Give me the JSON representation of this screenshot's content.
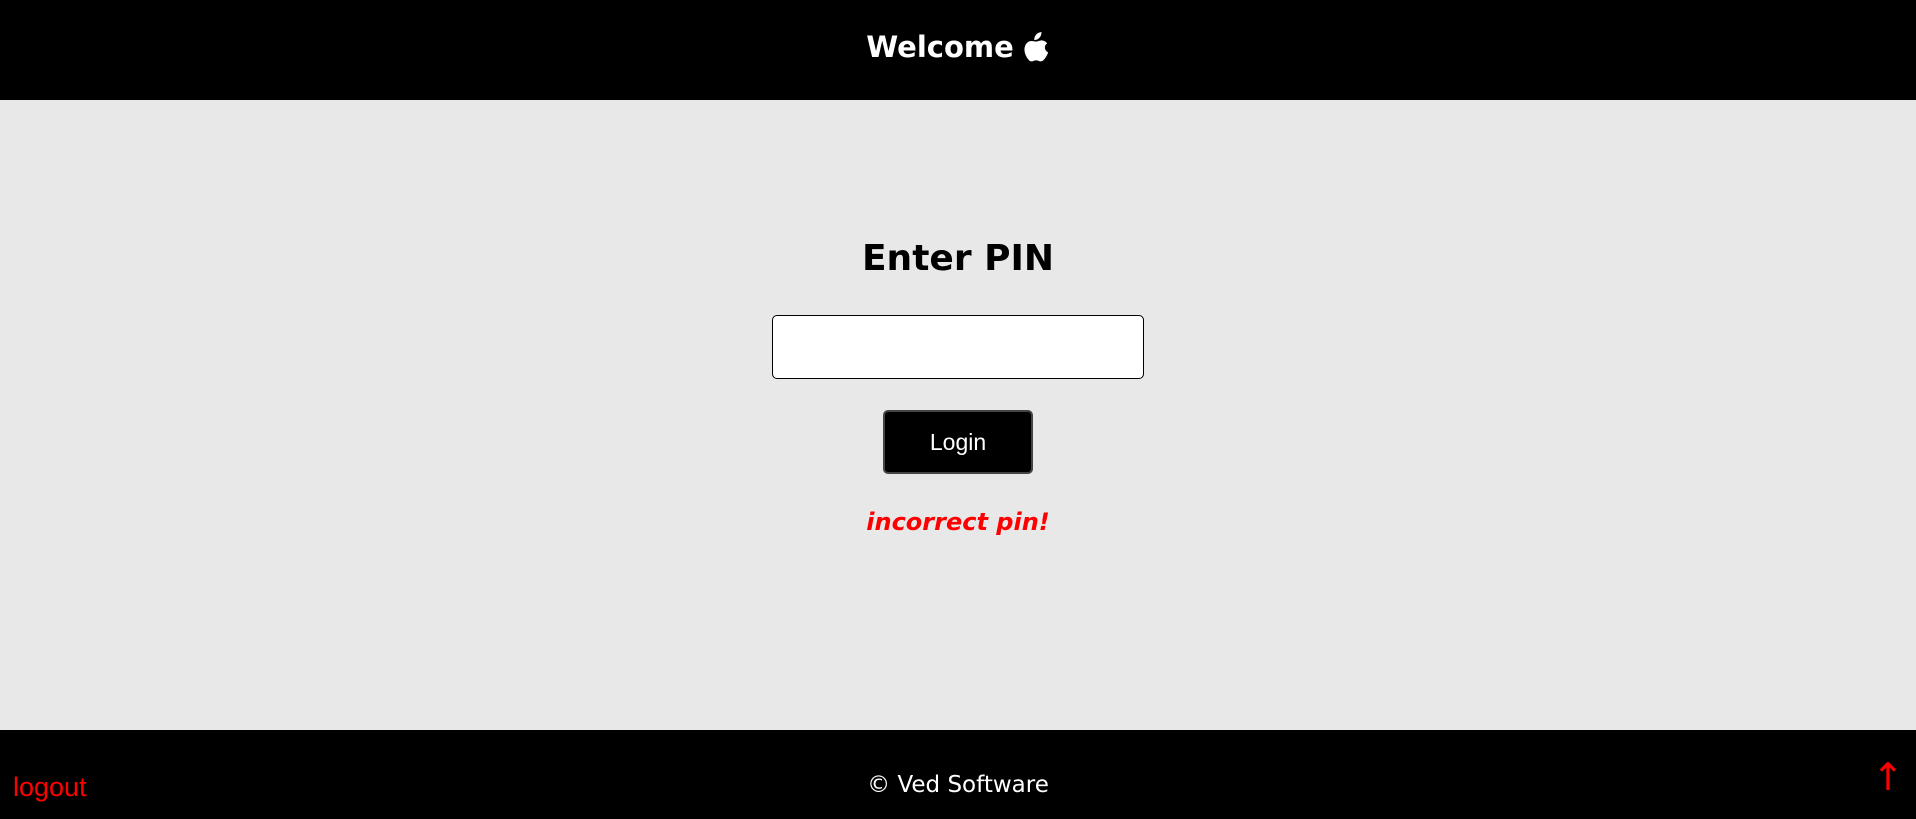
{
  "header": {
    "title": "Welcome",
    "icon": "apple-icon"
  },
  "login": {
    "heading": "Enter PIN",
    "pin_value": "",
    "pin_placeholder": "",
    "button_label": "Login",
    "error_message": "incorrect pin!"
  },
  "footer": {
    "logout_label": "logout",
    "copyright": "© Ved Software",
    "scroll_top_label": "↑",
    "scroll_top_icon": "arrow-up-icon"
  },
  "colors": {
    "header_bg": "#000000",
    "page_bg": "#e8e8e8",
    "error": "#ff0000",
    "link": "#ff0000"
  }
}
